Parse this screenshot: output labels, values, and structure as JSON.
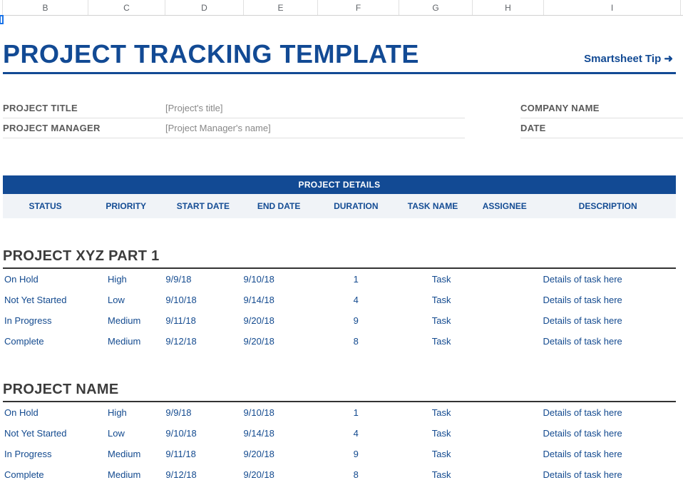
{
  "columns": {
    "b": "B",
    "c": "C",
    "d": "D",
    "e": "E",
    "f": "F",
    "g": "G",
    "h": "H",
    "i": "I"
  },
  "header": {
    "title": "PROJECT TRACKING TEMPLATE",
    "tip": "Smartsheet Tip ➜"
  },
  "meta": {
    "project_title_label": "PROJECT TITLE",
    "project_title_value": "[Project's title]",
    "project_manager_label": "PROJECT MANAGER",
    "project_manager_value": "[Project Manager's name]",
    "company_name_label": "COMPANY NAME",
    "date_label": "DATE"
  },
  "details_banner": "PROJECT DETAILS",
  "table_headers": {
    "status": "STATUS",
    "priority": "PRIORITY",
    "start_date": "START DATE",
    "end_date": "END DATE",
    "duration": "DURATION",
    "task_name": "TASK NAME",
    "assignee": "ASSIGNEE",
    "description": "DESCRIPTION"
  },
  "sections": [
    {
      "title": "PROJECT XYZ PART 1",
      "rows": [
        {
          "status": "On Hold",
          "priority": "High",
          "start": "9/9/18",
          "end": "9/10/18",
          "duration": "1",
          "task": "Task",
          "assignee": "",
          "desc": "Details of task here"
        },
        {
          "status": "Not Yet Started",
          "priority": "Low",
          "start": "9/10/18",
          "end": "9/14/18",
          "duration": "4",
          "task": "Task",
          "assignee": "",
          "desc": "Details of task here"
        },
        {
          "status": "In Progress",
          "priority": "Medium",
          "start": "9/11/18",
          "end": "9/20/18",
          "duration": "9",
          "task": "Task",
          "assignee": "",
          "desc": "Details of task here"
        },
        {
          "status": "Complete",
          "priority": "Medium",
          "start": "9/12/18",
          "end": "9/20/18",
          "duration": "8",
          "task": "Task",
          "assignee": "",
          "desc": "Details of task here"
        }
      ]
    },
    {
      "title": "PROJECT NAME",
      "rows": [
        {
          "status": "On Hold",
          "priority": "High",
          "start": "9/9/18",
          "end": "9/10/18",
          "duration": "1",
          "task": "Task",
          "assignee": "",
          "desc": "Details of task here"
        },
        {
          "status": "Not Yet Started",
          "priority": "Low",
          "start": "9/10/18",
          "end": "9/14/18",
          "duration": "4",
          "task": "Task",
          "assignee": "",
          "desc": "Details of task here"
        },
        {
          "status": "In Progress",
          "priority": "Medium",
          "start": "9/11/18",
          "end": "9/20/18",
          "duration": "9",
          "task": "Task",
          "assignee": "",
          "desc": "Details of task here"
        },
        {
          "status": "Complete",
          "priority": "Medium",
          "start": "9/12/18",
          "end": "9/20/18",
          "duration": "8",
          "task": "Task",
          "assignee": "",
          "desc": "Details of task here"
        }
      ]
    }
  ]
}
